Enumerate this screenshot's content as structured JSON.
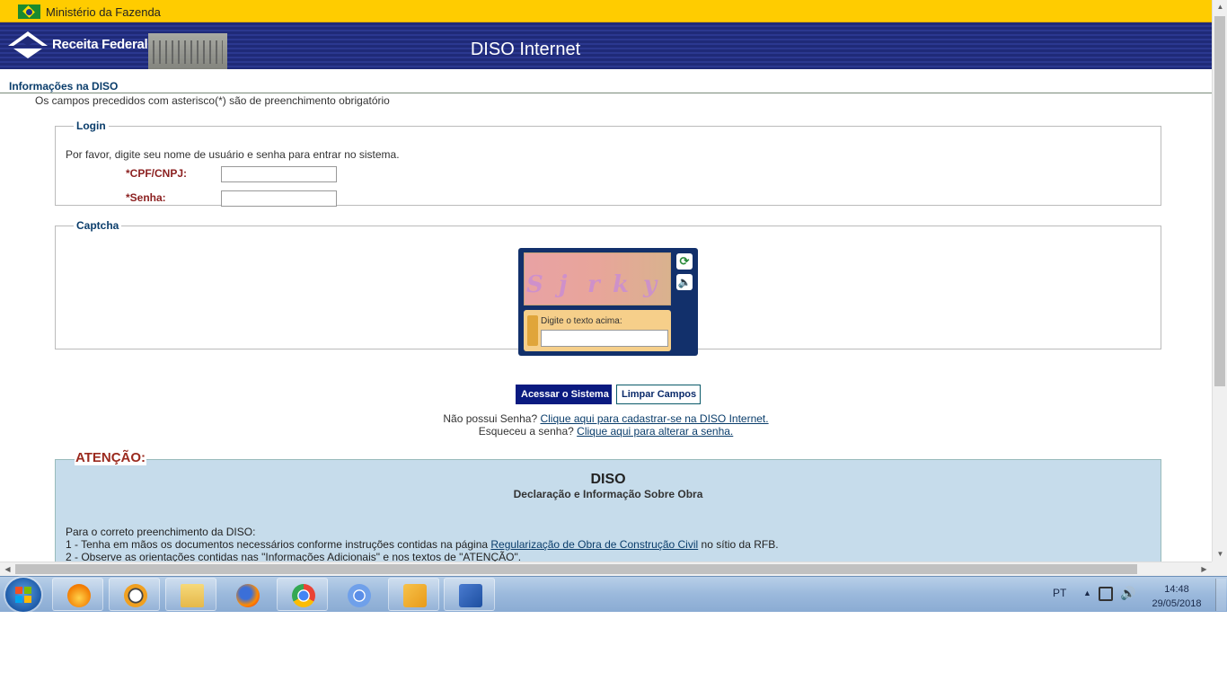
{
  "gov_bar": {
    "title": "Ministério da Fazenda"
  },
  "banner": {
    "brand": "Receita Federal",
    "app_title": "DISO Internet"
  },
  "page": {
    "heading": "Informações na DISO",
    "required_hint": "Os campos precedidos com asterisco(*) são de preenchimento obrigatório"
  },
  "login": {
    "legend": "Login",
    "message": "Por favor, digite seu nome de usuário e senha para entrar no sistema.",
    "cpf_label": "*CPF/CNPJ:",
    "cpf_value": "",
    "password_label": "*Senha:",
    "password_value": ""
  },
  "captcha": {
    "legend": "Captcha",
    "image_chars": [
      "S",
      "j",
      "r",
      "k",
      "y"
    ],
    "prompt": "Digite o texto acima:",
    "value": "",
    "refresh_icon": "refresh-icon",
    "audio_icon": "speaker-icon"
  },
  "actions": {
    "submit_label": "Acessar o Sistema",
    "clear_label": "Limpar Campos"
  },
  "links": {
    "no_password_text": "Não possui Senha?",
    "register_link": "Clique aqui para cadastrar-se na DISO Internet.",
    "forgot_text": "Esqueceu a senha?",
    "change_link": "Clique aqui para alterar a senha."
  },
  "attention": {
    "legend": "ATENÇÃO:",
    "title": "DISO",
    "subtitle": "Declaração e Informação Sobre Obra",
    "intro": "Para o correto preenchimento da DISO:",
    "item1_prefix": "1 - Tenha em mãos os documentos necessários conforme instruções contidas na página",
    "item1_link": "Regularização de Obra de Construção Civil",
    "item1_suffix": "no sítio da RFB.",
    "item2": "2 - Observe as orientações contidas nas \"Informações Adicionais\" e nos textos de \"ATENÇÃO\"."
  },
  "taskbar": {
    "apps": [
      {
        "name": "start-button"
      },
      {
        "name": "app-icon-1"
      },
      {
        "name": "app-icon-2"
      },
      {
        "name": "file-explorer-icon"
      },
      {
        "name": "firefox-icon"
      },
      {
        "name": "chrome-icon"
      },
      {
        "name": "chromium-icon"
      },
      {
        "name": "outlook-icon"
      },
      {
        "name": "word-icon"
      }
    ],
    "language": "PT",
    "time": "14:48",
    "date": "29/05/2018"
  },
  "colors": {
    "gov_bar": "#ffcc00",
    "banner": "#1f2a78",
    "heading": "#0a3d6b",
    "required_label": "#8b1f1f",
    "primary_button": "#0a1a80",
    "attention_bg": "#c6dceb",
    "attention_legend": "#9b2a1e"
  }
}
